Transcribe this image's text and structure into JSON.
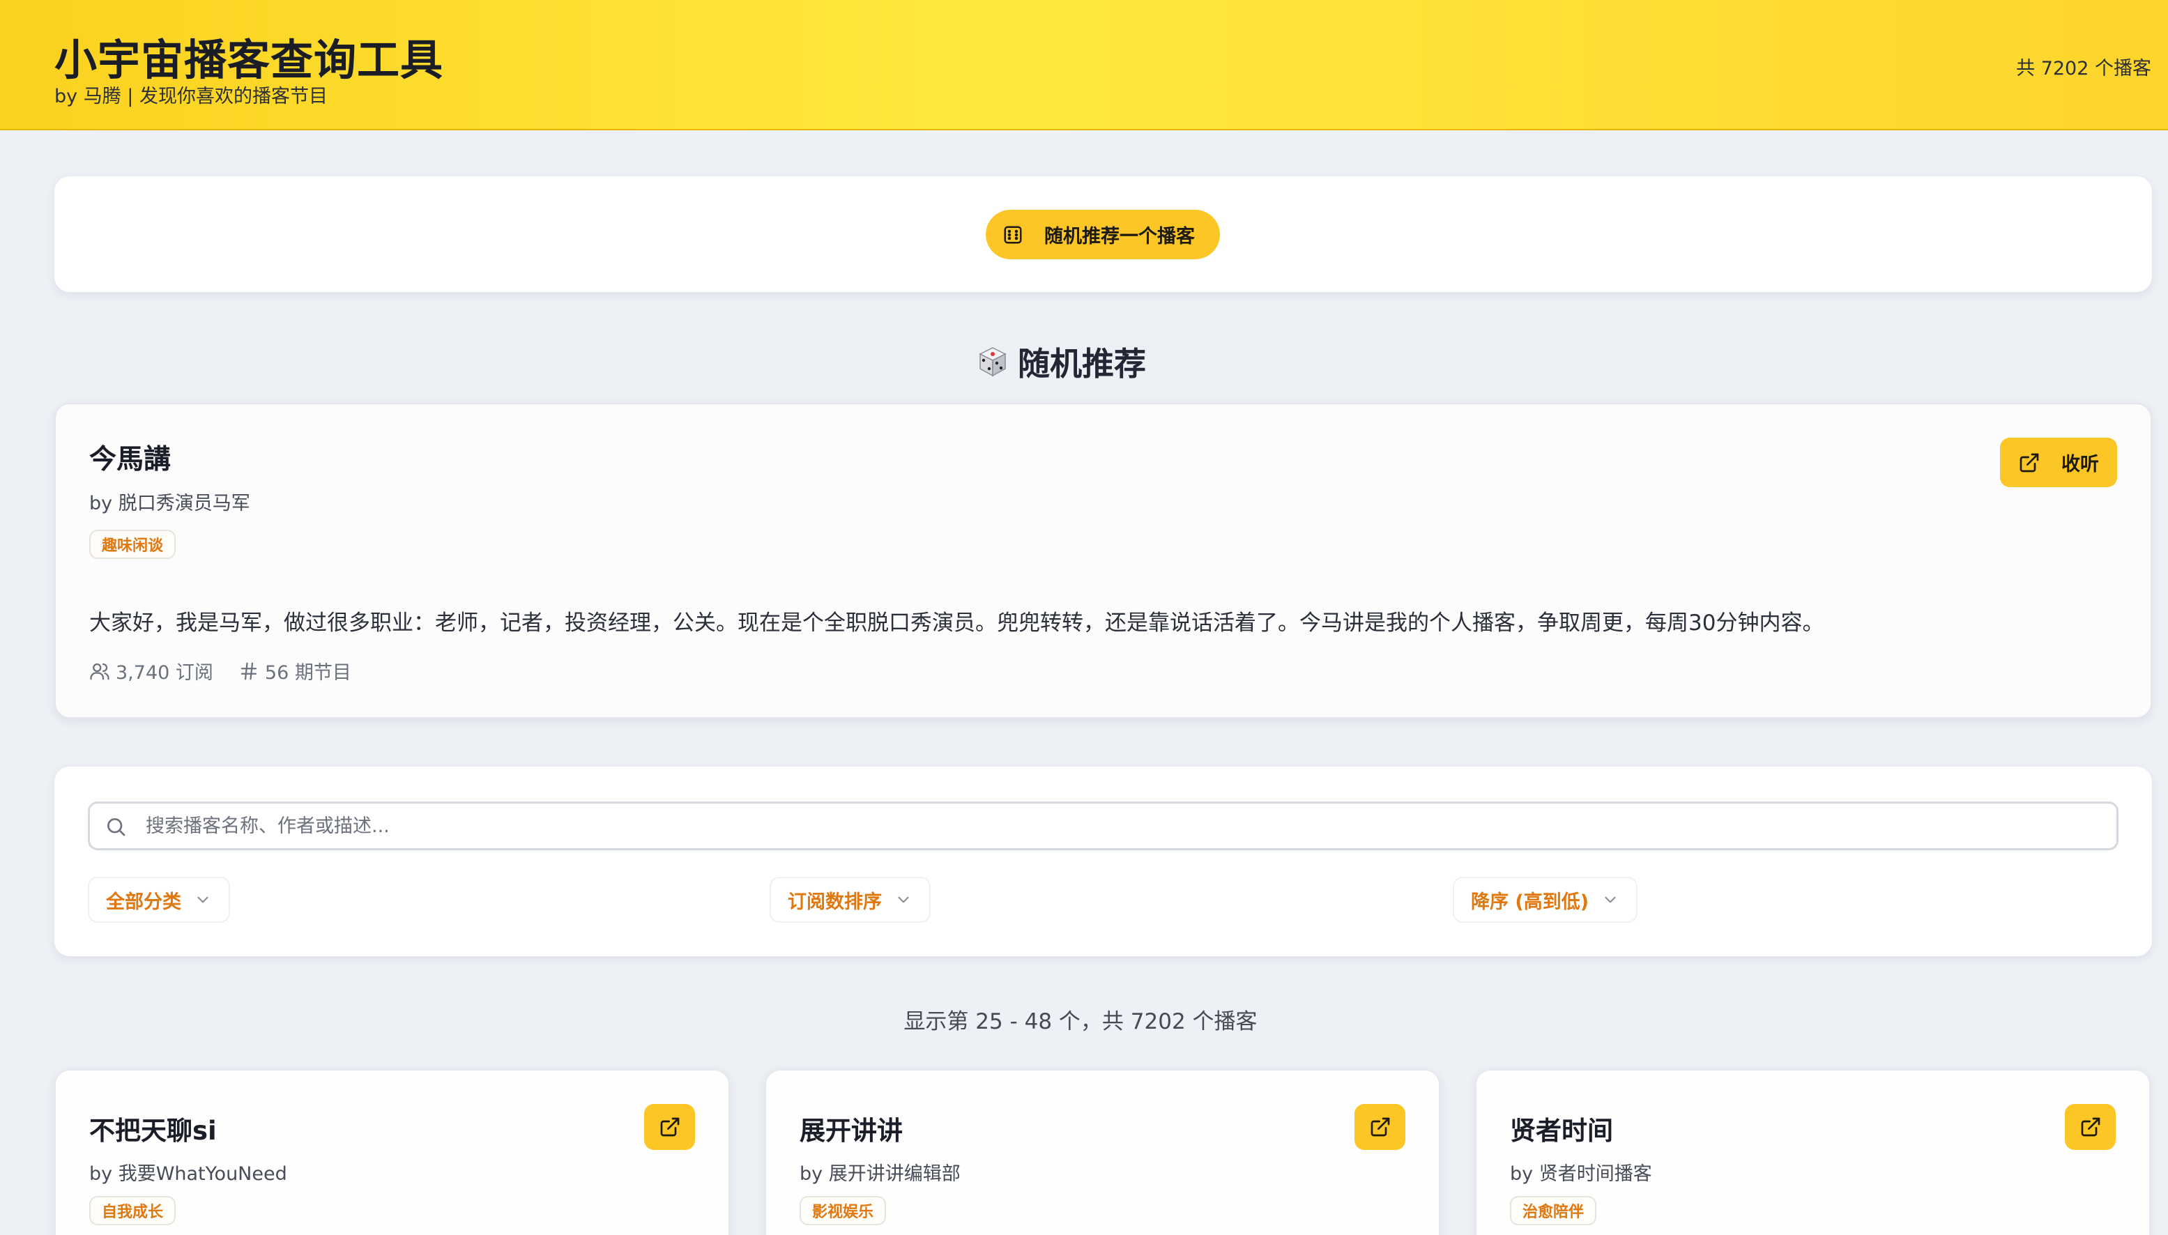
{
  "header": {
    "title": "小宇宙播客查询工具",
    "subtitle": "by 马腾 | 发现你喜欢的播客节目",
    "total": "共 7202 个播客"
  },
  "random": {
    "button_label": "随机推荐一个播客",
    "section_title": "随机推荐"
  },
  "featured": {
    "title": "今馬講",
    "author": "by 脱口秀演员马军",
    "tag": "趣味闲谈",
    "description": "大家好，我是马军，做过很多职业：老师，记者，投资经理，公关。现在是个全职脱口秀演员。兜兜转转，还是靠说话活着了。今马讲是我的个人播客，争取周更，每周30分钟内容。",
    "subscribers": "3,740 订阅",
    "episodes": "56 期节目",
    "listen_label": "收听"
  },
  "search": {
    "placeholder": "搜索播客名称、作者或描述..."
  },
  "filters": {
    "category": "全部分类",
    "sort": "订阅数排序",
    "order": "降序 (高到低)"
  },
  "results": {
    "info": "显示第 25 - 48 个，共 7202 个播客"
  },
  "podcasts": [
    {
      "title": "不把天聊si",
      "author": "by 我要WhatYouNeed",
      "tag": "自我成长"
    },
    {
      "title": "展开讲讲",
      "author": "by 展开讲讲编辑部",
      "tag": "影视娱乐"
    },
    {
      "title": "贤者时间",
      "author": "by 贤者时间播客",
      "tag": "治愈陪伴"
    }
  ],
  "colors": {
    "accent": "#fbc626",
    "header_gradient_start": "#fbd11f",
    "header_gradient_end": "#ffe93d",
    "tag_text": "#e0770f",
    "background": "#edf0f5"
  },
  "icons": {
    "random_button": "dice-icon",
    "section": "dice-emoji-icon",
    "listen": "external-link-icon",
    "search": "search-icon",
    "subscribers": "users-icon",
    "episodes": "hash-icon",
    "dropdown": "chevron-down-icon"
  }
}
